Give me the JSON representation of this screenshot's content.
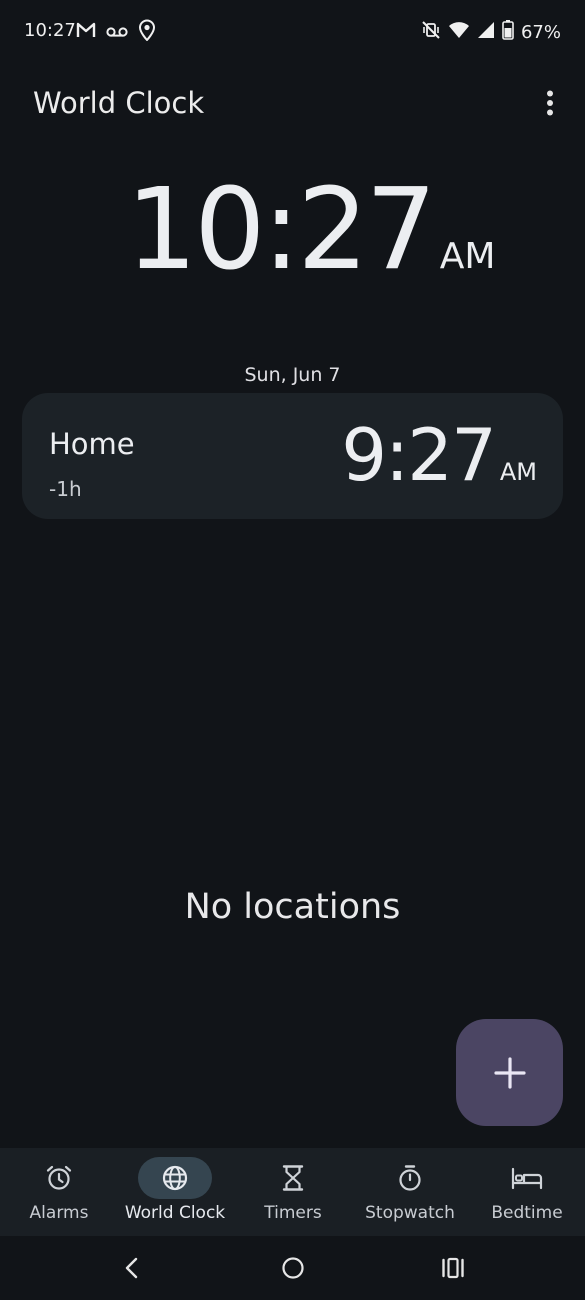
{
  "status_bar": {
    "time": "10:27",
    "battery_percent": "67%",
    "left_icons": [
      "gmail-icon",
      "voicemail-icon",
      "location-icon"
    ],
    "right_icons": [
      "vibrate-off-icon",
      "wifi-icon",
      "signal-icon",
      "battery-icon"
    ]
  },
  "header": {
    "title": "World Clock"
  },
  "clock": {
    "time": "10:27",
    "ampm": "AM",
    "date": "Sun, Jun 7"
  },
  "home_card": {
    "name": "Home",
    "offset": "-1h",
    "time": "9:27",
    "ampm": "AM"
  },
  "empty_state": {
    "text": "No locations"
  },
  "bottom_nav": {
    "items": [
      {
        "label": "Alarms",
        "icon": "alarm-icon"
      },
      {
        "label": "World Clock",
        "icon": "globe-icon",
        "active": true
      },
      {
        "label": "Timers",
        "icon": "hourglass-icon"
      },
      {
        "label": "Stopwatch",
        "icon": "stopwatch-icon"
      },
      {
        "label": "Bedtime",
        "icon": "bed-icon"
      }
    ]
  },
  "colors": {
    "background": "#111418",
    "card": "#1c2227",
    "fab": "#4b4563",
    "nav_bar": "#1a1f24",
    "nav_active_pill": "#354550"
  }
}
